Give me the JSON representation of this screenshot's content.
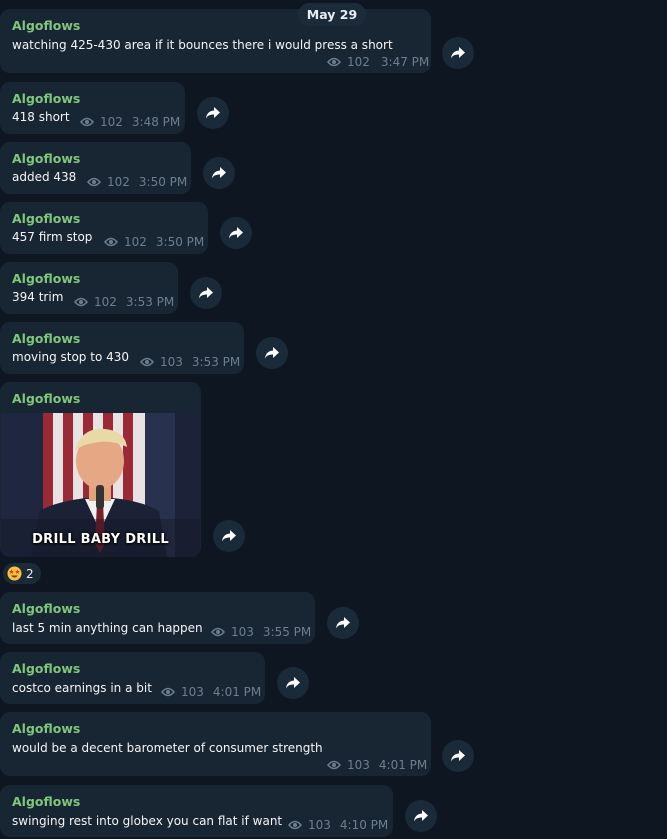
{
  "date_label": "May 29",
  "colors": {
    "background": "#0e1621",
    "bubble": "#182533",
    "sender": "#7fc77a",
    "meta": "#6d7f8f"
  },
  "messages": [
    {
      "sender": "Algoflows",
      "text": "watching 425-430 area if it bounces there i would press a short",
      "views": "102",
      "time": "3:47 PM"
    },
    {
      "sender": "Algoflows",
      "text": "418 short",
      "views": "102",
      "time": "3:48 PM"
    },
    {
      "sender": "Algoflows",
      "text": "added 438",
      "views": "102",
      "time": "3:50 PM"
    },
    {
      "sender": "Algoflows",
      "text": "457 firm stop",
      "views": "102",
      "time": "3:50 PM"
    },
    {
      "sender": "Algoflows",
      "text": "394 trim",
      "views": "102",
      "time": "3:53 PM"
    },
    {
      "sender": "Algoflows",
      "text": "moving stop to 430",
      "views": "103",
      "time": "3:53 PM"
    },
    {
      "sender": "Algoflows",
      "caption": "DRILL BABY DRILL",
      "reaction_emoji": "star-struck-emoji",
      "reaction_count": "2"
    },
    {
      "sender": "Algoflows",
      "text": "last 5 min anything can happen",
      "views": "103",
      "time": "3:55 PM"
    },
    {
      "sender": "Algoflows",
      "text": "costco earnings in a bit",
      "views": "103",
      "time": "4:01 PM"
    },
    {
      "sender": "Algoflows",
      "text": "would be a decent barometer of consumer strength",
      "views": "103",
      "time": "4:01 PM"
    },
    {
      "sender": "Algoflows",
      "text": "swinging rest into globex you can flat if want",
      "views": "103",
      "time": "4:10 PM"
    }
  ],
  "icons": {
    "views": "eye-icon",
    "share": "share-arrow-icon"
  }
}
